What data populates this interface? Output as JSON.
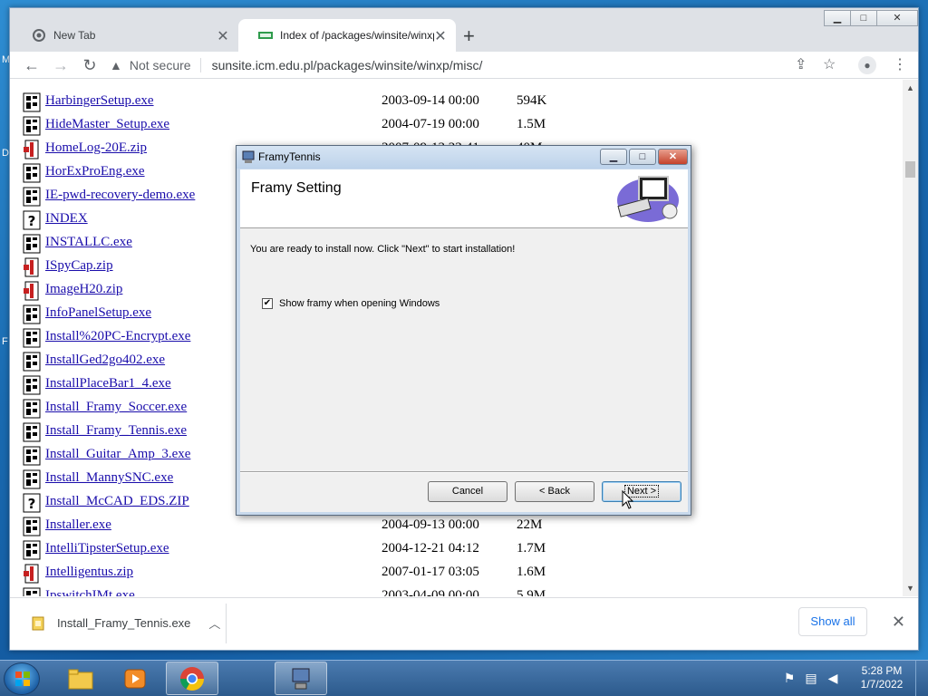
{
  "browser": {
    "tabs": [
      {
        "title": "New Tab"
      },
      {
        "title": "Index of /packages/winsite/winxp"
      }
    ],
    "address": {
      "security_label": "Not secure",
      "url": "sunsite.icm.edu.pl/packages/winsite/winxp/misc/"
    }
  },
  "listing": {
    "rows": [
      {
        "name": "HarbingerSetup.exe",
        "date": "2003-09-14 00:00",
        "size": "594K",
        "icon": "exe"
      },
      {
        "name": "HideMaster_Setup.exe",
        "date": "2004-07-19 00:00",
        "size": "1.5M",
        "icon": "exe"
      },
      {
        "name": "HomeLog-20E.zip",
        "date": "2007-09-13 23:41",
        "size": "40M",
        "icon": "zip"
      },
      {
        "name": "HorExProEng.exe",
        "date": "",
        "size": "",
        "icon": "exe"
      },
      {
        "name": "IE-pwd-recovery-demo.exe",
        "date": "",
        "size": "",
        "icon": "exe"
      },
      {
        "name": "INDEX",
        "date": "",
        "size": "",
        "icon": "unknown"
      },
      {
        "name": "INSTALLC.exe",
        "date": "",
        "size": "",
        "icon": "exe"
      },
      {
        "name": "ISpyCap.zip",
        "date": "",
        "size": "",
        "icon": "zip"
      },
      {
        "name": "ImageH20.zip",
        "date": "",
        "size": "",
        "icon": "zip"
      },
      {
        "name": "InfoPanelSetup.exe",
        "date": "",
        "size": "",
        "icon": "exe"
      },
      {
        "name": "Install%20PC-Encrypt.exe",
        "date": "",
        "size": "",
        "icon": "exe"
      },
      {
        "name": "InstallGed2go402.exe",
        "date": "",
        "size": "",
        "icon": "exe"
      },
      {
        "name": "InstallPlaceBar1_4.exe",
        "date": "",
        "size": "",
        "icon": "exe"
      },
      {
        "name": "Install_Framy_Soccer.exe",
        "date": "",
        "size": "",
        "icon": "exe"
      },
      {
        "name": "Install_Framy_Tennis.exe",
        "date": "",
        "size": "",
        "icon": "exe"
      },
      {
        "name": "Install_Guitar_Amp_3.exe",
        "date": "",
        "size": "",
        "icon": "exe"
      },
      {
        "name": "Install_MannySNC.exe",
        "date": "",
        "size": "",
        "icon": "exe"
      },
      {
        "name": "Install_McCAD_EDS.ZIP",
        "date": "",
        "size": "",
        "icon": "unknown"
      },
      {
        "name": "Installer.exe",
        "date": "2004-09-13 00:00",
        "size": "22M",
        "icon": "exe"
      },
      {
        "name": "IntelliTipsterSetup.exe",
        "date": "2004-12-21 04:12",
        "size": "1.7M",
        "icon": "exe"
      },
      {
        "name": "Intelligentus.zip",
        "date": "2007-01-17 03:05",
        "size": "1.6M",
        "icon": "zip"
      },
      {
        "name": "IpswitchIMt.exe",
        "date": "2003-04-09 00:00",
        "size": "5.9M",
        "icon": "exe"
      }
    ]
  },
  "download_bar": {
    "filename": "Install_Framy_Tennis.exe",
    "show_all_label": "Show all"
  },
  "dialog": {
    "window_title": "FramyTennis",
    "header_title": "Framy Setting",
    "message": "You are ready to install now. Click \"Next\" to start installation!",
    "checkbox_label": "Show framy when opening Windows",
    "checkbox_checked": true,
    "buttons": {
      "cancel": "Cancel",
      "back": "< Back",
      "next": "Next >"
    }
  },
  "taskbar": {
    "clock_time": "5:28 PM",
    "clock_date": "1/7/2022"
  },
  "colors": {
    "link": "#1a0dab",
    "taskbar": "#2c5a8c",
    "dialog_frame": "#c8d9ec"
  }
}
